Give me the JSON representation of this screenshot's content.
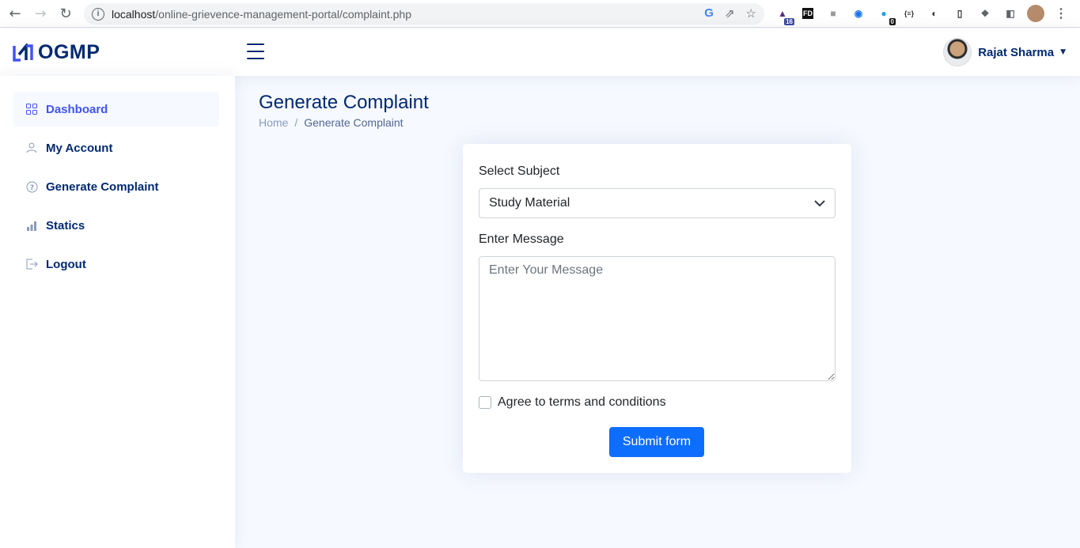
{
  "browser": {
    "url_host": "localhost",
    "url_path": "/online-grievence-management-portal/complaint.php",
    "extension_badges": [
      "16",
      "0"
    ],
    "extension_labels": [
      "FD",
      "{≡}"
    ]
  },
  "header": {
    "logo_text": "OGMP",
    "user_name": "Rajat Sharma"
  },
  "sidebar": {
    "items": [
      {
        "label": "Dashboard",
        "icon": "grid-icon",
        "active": true
      },
      {
        "label": "My Account",
        "icon": "person-icon",
        "active": false
      },
      {
        "label": "Generate Complaint",
        "icon": "question-circle-icon",
        "active": false
      },
      {
        "label": "Statics",
        "icon": "bar-chart-icon",
        "active": false
      },
      {
        "label": "Logout",
        "icon": "logout-icon",
        "active": false
      }
    ]
  },
  "main": {
    "page_title": "Generate Complaint",
    "breadcrumb": {
      "home": "Home",
      "separator": "/",
      "current": "Generate Complaint"
    },
    "form": {
      "subject_label": "Select Subject",
      "subject_value": "Study Material",
      "message_label": "Enter Message",
      "message_placeholder": "Enter Your Message",
      "terms_label": "Agree to terms and conditions",
      "submit_label": "Submit form"
    }
  },
  "colors": {
    "accent": "#4154f1",
    "navy": "#012970",
    "button": "#0d6efd",
    "page_bg": "#f6f9ff"
  }
}
